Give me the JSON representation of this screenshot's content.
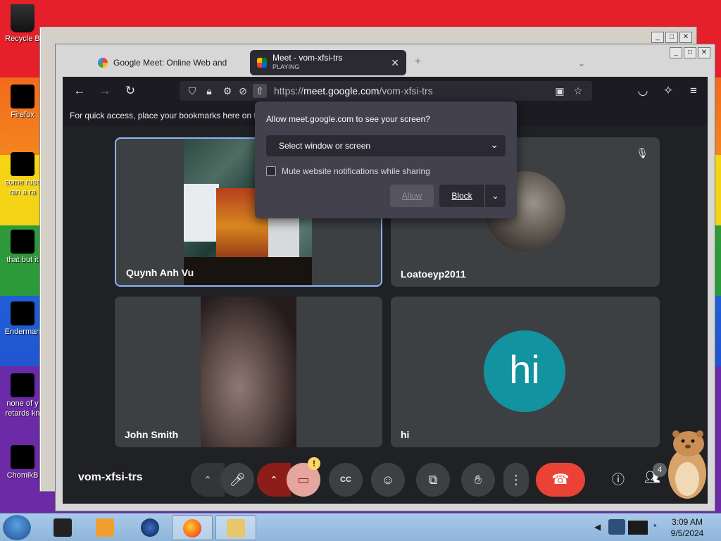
{
  "desktop": {
    "icons": [
      {
        "label": "Recycle B"
      },
      {
        "label": "Firefox"
      },
      {
        "label": "some russ ran a ra"
      },
      {
        "label": "that but it"
      },
      {
        "label": "Enderman"
      },
      {
        "label": "none of y retards kn"
      },
      {
        "label": "ChomikB"
      }
    ]
  },
  "browser": {
    "tabs": [
      {
        "title": "Google Meet: Online Web and",
        "active": false
      },
      {
        "title": "Meet - vom-xfsi-trs",
        "subtitle": "PLAYING",
        "active": true
      }
    ],
    "close_glyph": "✕",
    "url_prefix": "https://",
    "url_host": "meet.google.com",
    "url_path": "/vom-xfsi-trs",
    "bookmarks_hint": "For quick access, place your bookmarks here on th"
  },
  "permission_popup": {
    "title": "Allow meet.google.com to see your screen?",
    "select_value": "Select window or screen",
    "checkbox_label": "Mute website notifications while sharing",
    "allow_label": "Allow",
    "block_label": "Block"
  },
  "meet": {
    "participants": [
      {
        "name": "Quynh Anh Vu"
      },
      {
        "name": "Loatoeyp2011"
      },
      {
        "name": "John Smith"
      },
      {
        "name": "hi",
        "avatar_text": "hi",
        "avatar_color": "#12939f"
      }
    ],
    "meeting_code": "vom-xfsi-trs",
    "participant_count": "4",
    "warning_glyph": "!"
  },
  "taskbar": {
    "time": "3:09 AM",
    "date": "9/5/2024"
  }
}
